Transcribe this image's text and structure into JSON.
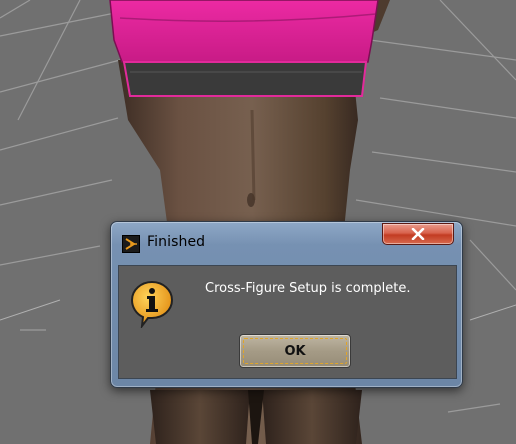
{
  "dialog": {
    "title": "Finished",
    "message": "Cross-Figure Setup is complete.",
    "ok_label": "OK",
    "icons": {
      "app": "app-arrow-icon",
      "info": "info-speech-bubble-icon",
      "close": "close-x-icon"
    }
  },
  "colors": {
    "titlebar": "#7691b2",
    "close_button": "#c23b22",
    "client_background": "#5d5d5d",
    "info_icon": "#f0a020",
    "top_garment": "#e0208f"
  }
}
